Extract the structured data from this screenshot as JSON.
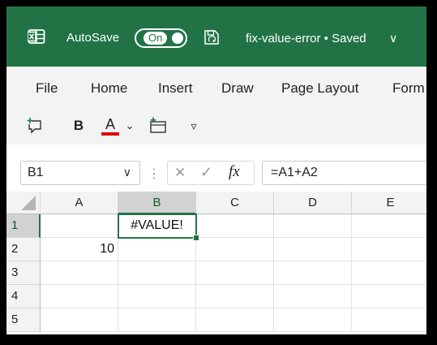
{
  "title_bar": {
    "autosave_label": "AutoSave",
    "toggle_label": "On",
    "file_title": "fix-value-error • Saved",
    "chevron": "∨",
    "accent_color": "#217346"
  },
  "ribbon": {
    "tabs": [
      "File",
      "Home",
      "Insert",
      "Draw",
      "Page Layout",
      "Form"
    ],
    "qat": {
      "bold": "B",
      "font_color": "A",
      "chevron": "⌄",
      "more": "▿"
    }
  },
  "formula_bar": {
    "namebox_value": "B1",
    "namebox_chevron": "∨",
    "separator": "⋮",
    "cancel_glyph": "✕",
    "confirm_glyph": "✓",
    "fx_label": "fx",
    "formula": "=A1+A2"
  },
  "sheet": {
    "columns": [
      "A",
      "B",
      "C",
      "D",
      "E"
    ],
    "rows": [
      "1",
      "2",
      "3",
      "4",
      "5"
    ],
    "cells": {
      "B1": "#VALUE!",
      "A2": "10"
    },
    "active_cell": "B1"
  }
}
